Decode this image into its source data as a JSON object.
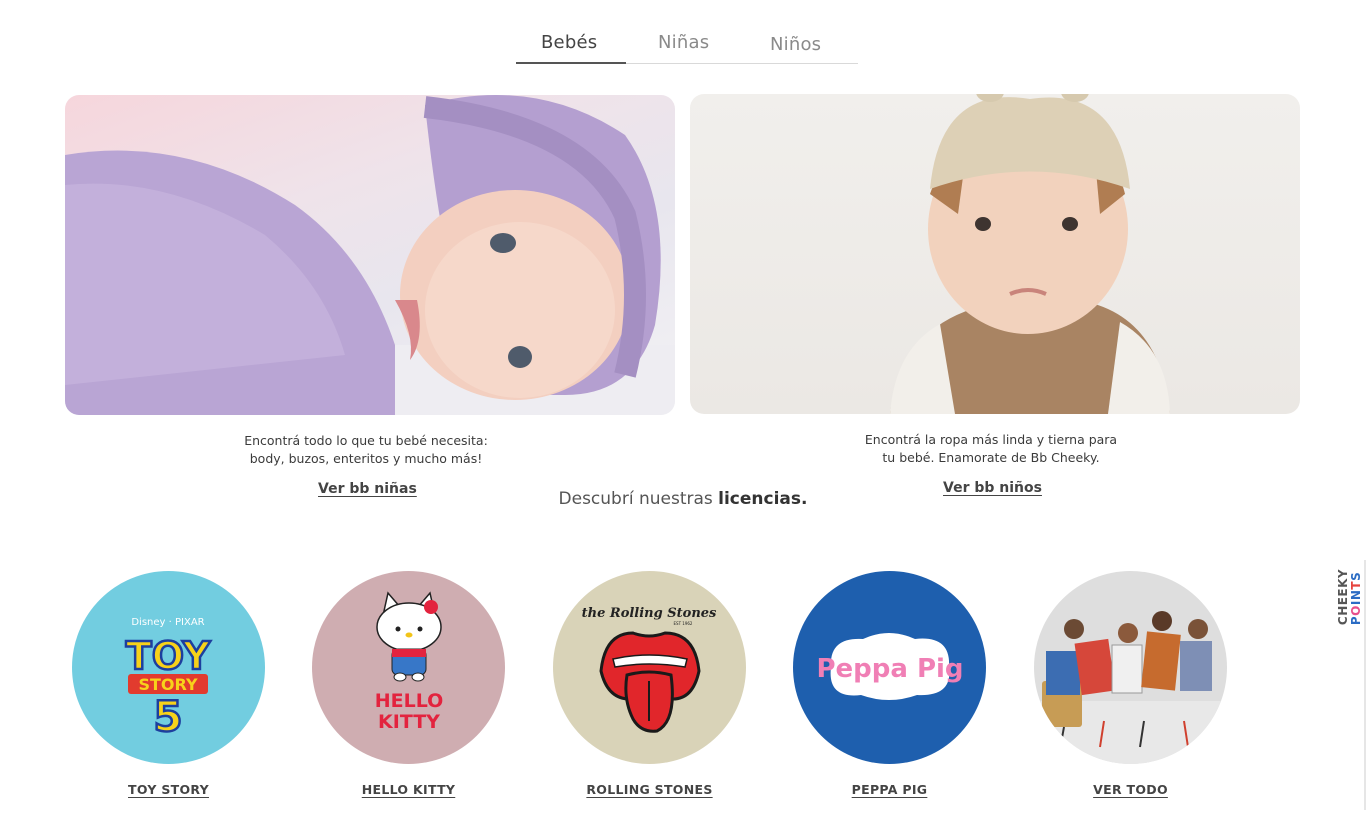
{
  "tabs": {
    "items": [
      {
        "label": "Bebés",
        "active": true
      },
      {
        "label": "Niñas",
        "active": false
      },
      {
        "label": "Niños",
        "active": false
      }
    ]
  },
  "banners": [
    {
      "description_line1": "Encontrá todo lo que tu bebé necesita:",
      "description_line2": "body, buzos, enteritos y mucho más!",
      "link": "Ver bb niñas"
    },
    {
      "description_line1": "Encontrá la ropa más linda y tierna para",
      "description_line2": "tu bebé. Enamorate de Bb Cheeky.",
      "link": "Ver bb niños"
    }
  ],
  "licenses": {
    "title_prefix": "Descubrí nuestras",
    "title_bold": "licencias.",
    "items": [
      {
        "label": "TOY STORY",
        "logo_text": [
          "Disney · PIXAR",
          "TOY",
          "STORY",
          "5"
        ],
        "bg": "#72cde0"
      },
      {
        "label": "HELLO KITTY",
        "logo_text": [
          "HELLO",
          "KITTY"
        ],
        "bg": "#cfadb1"
      },
      {
        "label": "ROLLING STONES",
        "logo_text": [
          "the Rolling Stones",
          "EST 1962"
        ],
        "bg": "#d9d3b8"
      },
      {
        "label": "PEPPA PIG",
        "logo_text": [
          "Peppa Pig"
        ],
        "bg": "#1e5fae"
      },
      {
        "label": "VER TODO",
        "bg": "#dcdcdc"
      }
    ]
  },
  "cheeky_points": {
    "line1": "CHEEKY",
    "line2_letters": [
      "P",
      "O",
      "I",
      "N",
      "T",
      "S"
    ],
    "line2_colors": [
      "#2b6cc4",
      "#e8508b",
      "#2b6cc4",
      "#2b6cc4",
      "#e6433c",
      "#2b6cc4"
    ]
  }
}
